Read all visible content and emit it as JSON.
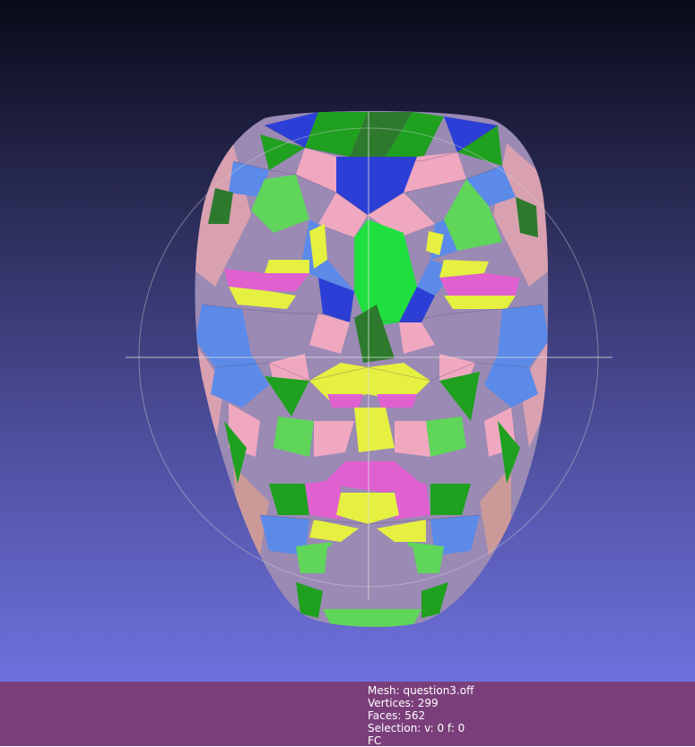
{
  "viewer": {
    "model": "face-mesh",
    "trackball": true,
    "palette": [
      "#2b3fd6",
      "#1fa01f",
      "#5fd65a",
      "#5b8ae8",
      "#f0a8c0",
      "#9a8ab4",
      "#e6f040",
      "#e060d0",
      "#20e040",
      "#2d7a2d",
      "#cc9999"
    ]
  },
  "info": {
    "mesh_label": "Mesh: question3.off",
    "vertices_label": "Vertices: 299",
    "faces_label": "Faces: 562",
    "selection_label": "Selection: v: 0 f: 0",
    "mode_label": "FC"
  }
}
